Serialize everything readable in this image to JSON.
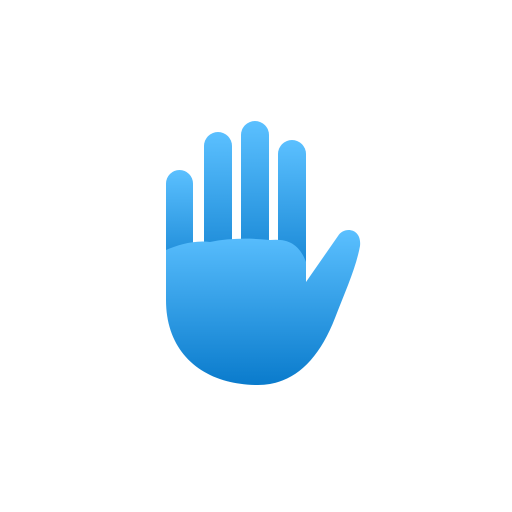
{
  "icon": {
    "name": "raised-hand-icon",
    "gradient_top": "#5BC0FF",
    "gradient_bottom": "#0A7BCC",
    "background": "#FFFFFF"
  }
}
